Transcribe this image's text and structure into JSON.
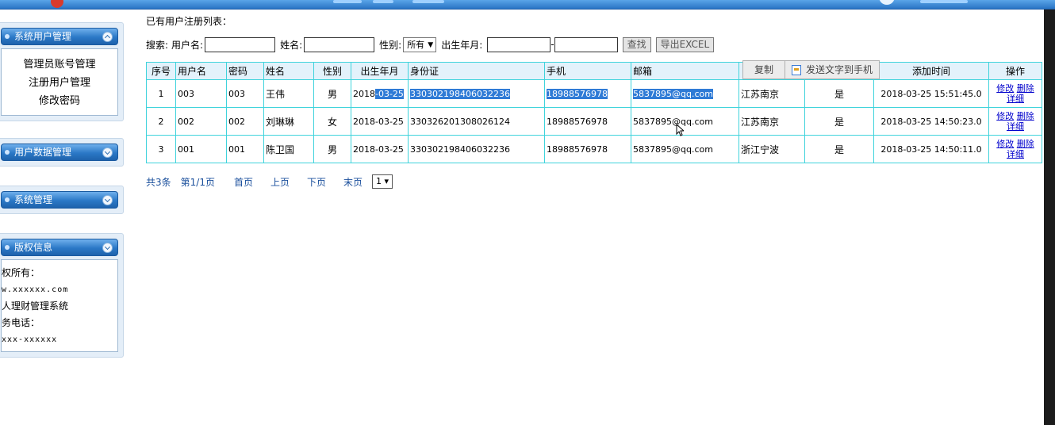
{
  "sidebar": {
    "panels": [
      {
        "title": "系统用户管理",
        "items": [
          "管理员账号管理",
          "注册用户管理",
          "修改密码"
        ]
      },
      {
        "title": "用户数据管理"
      },
      {
        "title": "系统管理"
      },
      {
        "title": "版权信息",
        "lines": [
          "权所有：",
          "w.xxxxxx.com",
          "人理财管理系统",
          "务电话：",
          "xxx-xxxxxx"
        ]
      }
    ]
  },
  "main": {
    "title": "已有用户注册列表：",
    "search": {
      "label": "搜索:",
      "username_label": "用户名:",
      "name_label": "姓名:",
      "gender_label": "性别:",
      "gender_value": "所有",
      "birth_label": "出生年月:",
      "range_sep": "-",
      "search_button": "查找",
      "export_button": "导出EXCEL"
    },
    "copy_toolbar": {
      "copy": "复制",
      "send": "发送文字到手机"
    },
    "table": {
      "headers": [
        "序号",
        "用户名",
        "密码",
        "姓名",
        "性别",
        "出生年月",
        "身份证",
        "手机",
        "邮箱",
        "",
        "",
        "添加时间",
        "操作"
      ],
      "rows": [
        {
          "no": "1",
          "username": "003",
          "password": "003",
          "name": "王伟",
          "gender": "男",
          "birth_a": "2018",
          "birth_b": "-03-25",
          "id": "330302198406032236",
          "phone": "18988576978",
          "email": "5837895@qq.com",
          "address": "江苏南京",
          "flag": "是",
          "added": "2018-03-25 15:51:45.0"
        },
        {
          "no": "2",
          "username": "002",
          "password": "002",
          "name": "刘琳琳",
          "gender": "女",
          "birth": "2018-03-25",
          "id": "330326201308026124",
          "phone": "18988576978",
          "email": "5837895@qq.com",
          "address": "江苏南京",
          "flag": "是",
          "added": "2018-03-25 14:50:23.0"
        },
        {
          "no": "3",
          "username": "001",
          "password": "001",
          "name": "陈卫国",
          "gender": "男",
          "birth": "2018-03-25",
          "id": "330302198406032236",
          "phone": "18988576978",
          "email": "5837895@qq.com",
          "address": "浙江宁波",
          "flag": "是",
          "added": "2018-03-25 14:50:11.0"
        }
      ],
      "ops": {
        "edit": "修改",
        "delete": "删除",
        "detail": "详细"
      }
    },
    "pager": {
      "total": "共3条",
      "page": "第1/1页",
      "first": "首页",
      "prev": "上页",
      "next": "下页",
      "last": "末页",
      "select_value": "1 ▾"
    }
  }
}
